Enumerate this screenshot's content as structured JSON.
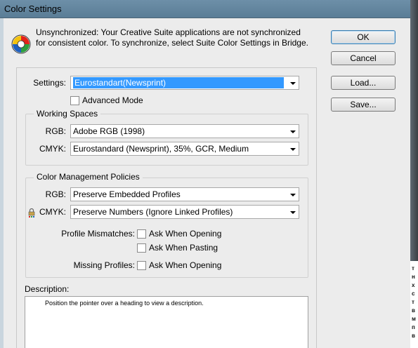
{
  "window": {
    "title": "Color Settings"
  },
  "sync_message": {
    "line1": "Unsynchronized: Your Creative Suite applications are not synchronized",
    "line2": "for consistent color. To synchronize, select Suite Color Settings in Bridge."
  },
  "buttons": {
    "ok": "OK",
    "cancel": "Cancel",
    "load": "Load...",
    "save": "Save..."
  },
  "settings": {
    "label": "Settings:",
    "value": "Eurostandart(Newsprint)",
    "advanced_mode": {
      "label": "Advanced Mode",
      "checked": false
    }
  },
  "working_spaces": {
    "title": "Working Spaces",
    "rgb_label": "RGB:",
    "rgb_value": "Adobe RGB (1998)",
    "cmyk_label": "CMYK:",
    "cmyk_value": "Eurostandard (Newsprint), 35%, GCR, Medium"
  },
  "policies": {
    "title": "Color Management Policies",
    "rgb_label": "RGB:",
    "rgb_value": "Preserve Embedded Profiles",
    "cmyk_label": "CMYK:",
    "cmyk_value": "Preserve Numbers (Ignore Linked Profiles)",
    "profile_mismatches_label": "Profile Mismatches:",
    "ask_when_opening": "Ask When Opening",
    "ask_when_pasting": "Ask When Pasting",
    "missing_profiles_label": "Missing Profiles:",
    "missing_ask_when_opening": "Ask When Opening"
  },
  "description": {
    "label": "Description:",
    "text": "Position the pointer over a heading to view a description."
  },
  "colors": {
    "selection": "#3399ff",
    "default_button_border": "#3c7fb1"
  }
}
